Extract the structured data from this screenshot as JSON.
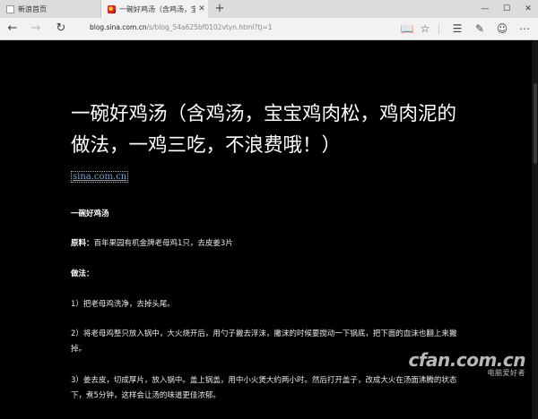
{
  "tabs": [
    {
      "title": "新浪首页",
      "active": false,
      "favicon": "page-icon"
    },
    {
      "title": "一碗好鸡汤（含鸡汤，宝",
      "active": true,
      "favicon": "sina-logo-icon",
      "close": "✕"
    }
  ],
  "window": {
    "minimize": "—",
    "maximize": "☐",
    "close": "✕",
    "new_tab": "+"
  },
  "nav": {
    "back": "←",
    "forward": "→",
    "refresh": "↻",
    "url_host": "blog.sina.com.cn",
    "url_path": "/s/blog_54a625bf0102vtyn.html?tj=1"
  },
  "toolbar": {
    "reading_view": "📖",
    "favorite": "☆",
    "hub": "☰",
    "web_note": "✎",
    "feedback": "☺",
    "more": "⋯"
  },
  "article": {
    "title": "一碗好鸡汤（含鸡汤，宝宝鸡肉松，鸡肉泥的做法，一鸡三吃，不浪费哦！）",
    "source": "sina.com.cn",
    "heading1": "一碗好鸡汤",
    "ingredients_label": "原料：",
    "ingredients_text": "百年果园有机金牌老母鸡1只，去皮姜3片",
    "method_label": "做法：",
    "step1": "1）把老母鸡洗净，去掉头尾。",
    "step2": "2）将老母鸡整只放入锅中，大火烧开后，用勺子撇去浮沫，撇沫的时候要搅动一下锅底，把下面的血沫也翻上来撇掉。",
    "step3": "3）姜去皮，切成厚片，放入锅中。盖上锅盖，用中小火煲大约两小时。然后打开盖子，改成大火在汤面沸腾的状态下，煮5分钟，这样会让汤的味道更佳浓郁。"
  },
  "watermark": {
    "brand": "cfan.com.cn",
    "sub": "电脑爱好者"
  },
  "colors": {
    "page_bg": "#000000",
    "link": "#6fa3ee",
    "chrome": "#f2f2f2",
    "tabbar": "#dcdcdc"
  }
}
